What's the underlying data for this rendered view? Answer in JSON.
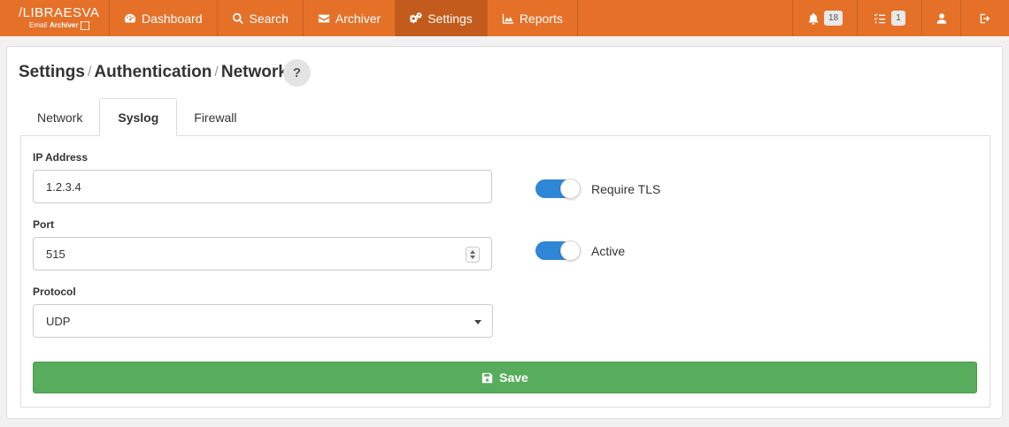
{
  "brand": {
    "name": "/LIBRAESVA",
    "sub_prefix": "Email",
    "sub_bold": "Archiver"
  },
  "nav": {
    "dashboard": "Dashboard",
    "search": "Search",
    "archiver": "Archiver",
    "settings": "Settings",
    "reports": "Reports",
    "notifications_count": "18",
    "tasks_count": "1"
  },
  "breadcrumb": {
    "part1": "Settings",
    "part2": "Authentication",
    "part3": "Network",
    "separator": "/",
    "help": "?"
  },
  "tabs": [
    "Network",
    "Syslog",
    "Firewall"
  ],
  "active_tab": "Syslog",
  "form": {
    "ip_label": "IP Address",
    "ip_value": "1.2.3.4",
    "port_label": "Port",
    "port_value": "515",
    "protocol_label": "Protocol",
    "protocol_value": "UDP",
    "require_tls_label": "Require TLS",
    "require_tls_on": true,
    "active_label": "Active",
    "active_on": true,
    "save_label": "Save"
  },
  "colors": {
    "nav_bg": "#e57129",
    "nav_active": "#c25b1b",
    "toggle_on": "#2e86d6",
    "save_btn": "#57ad5b"
  },
  "icons": {
    "dashboard": "dashboard-icon",
    "search": "search-icon",
    "archiver": "envelope-icon",
    "settings": "gears-icon",
    "reports": "area-chart-icon",
    "notifications": "bell-icon",
    "tasks": "tasks-icon",
    "user": "user-icon",
    "logout": "logout-icon",
    "save": "floppy-disk-icon"
  }
}
